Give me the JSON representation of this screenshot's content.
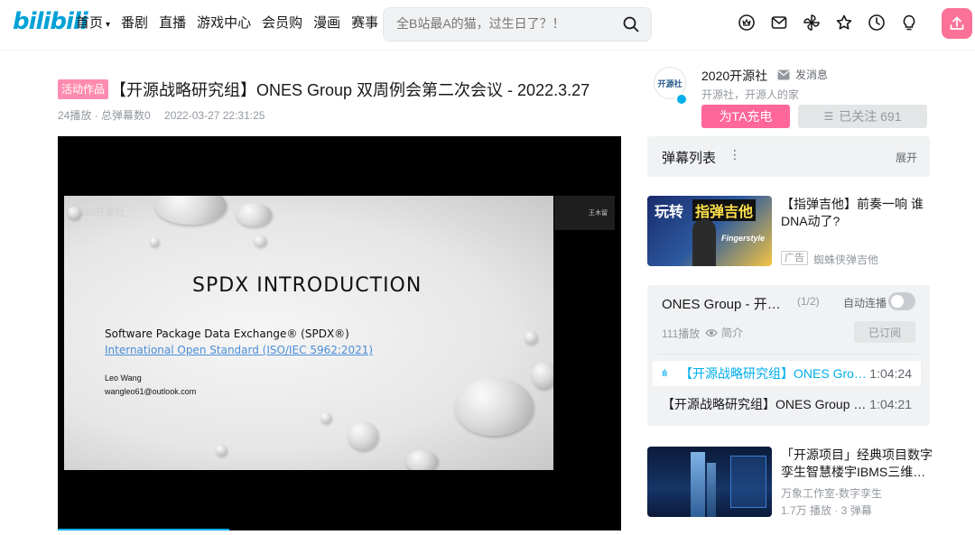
{
  "header": {
    "logo": "bilibili",
    "nav": [
      {
        "label": "首页",
        "has_dropdown": true
      },
      {
        "label": "番剧"
      },
      {
        "label": "直播"
      },
      {
        "label": "游戏中心"
      },
      {
        "label": "会员购"
      },
      {
        "label": "漫画"
      },
      {
        "label": "赛事"
      }
    ],
    "search_placeholder": "全B站最A的猫，过生日了？！",
    "icons": [
      "crown-icon",
      "mail-icon",
      "pinwheel-icon",
      "star-icon",
      "clock-icon",
      "bulb-icon",
      "upload-icon"
    ]
  },
  "video": {
    "tag": "活动作品",
    "title": "【开源战略研究组】ONES Group 双周例会第二次会议 - 2022.3.27",
    "views": "24播放 · 总弹幕数0",
    "date": "2022-03-27 22:31:25",
    "slide": {
      "watermark": "2020开源社",
      "heading": "SPDX INTRODUCTION",
      "subtitle": "Software Package Data Exchange® (SPDX®)",
      "link": "International Open Standard (ISO/IEC 5962:2021)",
      "author": "Leo Wang",
      "email": "wangleo61@outlook.com"
    },
    "camera_name": "王木留"
  },
  "uploader": {
    "avatar_text": "开源社",
    "name": "2020开源社",
    "message_label": "发消息",
    "description": "开源社，开源人的家",
    "charge_label": "为TA充电",
    "follow_label": "已关注 691"
  },
  "danmaku": {
    "title": "弹幕列表",
    "more": "⋮",
    "expand": "展开"
  },
  "ad": {
    "thumb_text_1": "玩转",
    "thumb_text_2": "指弹吉他",
    "thumb_text_3": "Fingerstyle",
    "title": "【指弹吉他】前奏一响 谁DNA动了?",
    "badge": "广告",
    "author": "蜘蛛侠弹吉他"
  },
  "playlist": {
    "title": "ONES Group - 开…",
    "count": "(1/2)",
    "autoplay_label": "自动连播",
    "views": "111播放",
    "intro_label": "简介",
    "subscribe_label": "已订阅",
    "items": [
      {
        "title": "【开源战略研究组】ONES Grou…",
        "duration": "1:04:24",
        "active": true
      },
      {
        "title": "【开源战略研究组】ONES Group 双…",
        "duration": "1:04:21",
        "active": false
      }
    ]
  },
  "recommend": {
    "title": "「开源项目」经典项目数字孪生智慧楼宇IBMS三维…",
    "author": "万象工作室-数字孪生",
    "stats": "1.7万 播放 · 3 弹幕"
  }
}
